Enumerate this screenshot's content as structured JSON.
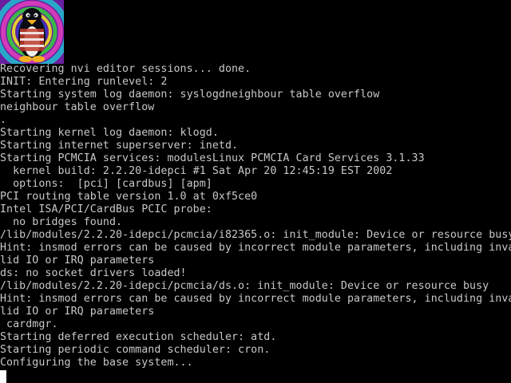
{
  "colors": {
    "background": "#000000",
    "text": "#c8c8c8",
    "cursor": "#ffffff"
  },
  "logo": {
    "icon": "tux-penguin-icon"
  },
  "console": {
    "lines": [
      "Recovering nvi editor sessions... done.",
      "INIT: Entering runlevel: 2",
      "Starting system log daemon: syslogdneighbour table overflow",
      "neighbour table overflow",
      ".",
      "Starting kernel log daemon: klogd.",
      "Starting internet superserver: inetd.",
      "Starting PCMCIA services: modulesLinux PCMCIA Card Services 3.1.33",
      "  kernel build: 2.2.20-idepci #1 Sat Apr 20 12:45:19 EST 2002",
      "  options:  [pci] [cardbus] [apm]",
      "PCI routing table version 1.0 at 0xf5ce0",
      "Intel ISA/PCI/CardBus PCIC probe:",
      "  no bridges found.",
      "/lib/modules/2.2.20-idepci/pcmcia/i82365.o: init_module: Device or resource busy",
      "Hint: insmod errors can be caused by incorrect module parameters, including inva",
      "lid IO or IRQ parameters",
      "ds: no socket drivers loaded!",
      "/lib/modules/2.2.20-idepci/pcmcia/ds.o: init_module: Device or resource busy",
      "Hint: insmod errors can be caused by incorrect module parameters, including inva",
      "lid IO or IRQ parameters",
      " cardmgr.",
      "Starting deferred execution scheduler: atd.",
      "Starting periodic command scheduler: cron.",
      "Configuring the base system..."
    ]
  }
}
